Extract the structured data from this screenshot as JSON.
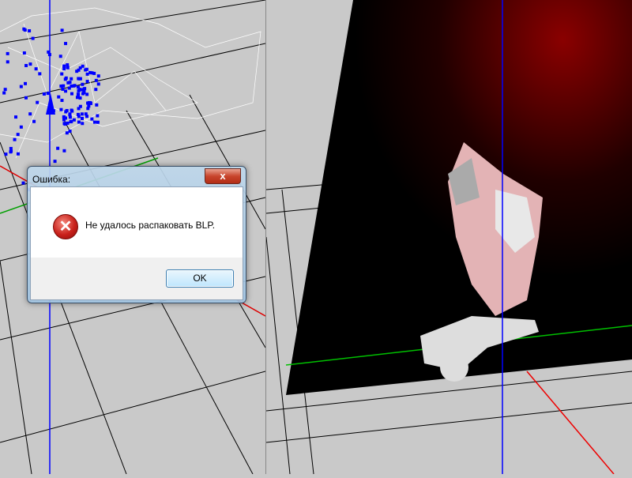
{
  "dialog": {
    "title": "Ошибка:",
    "close_label": "x",
    "icon": "error-icon",
    "message": "Не удалось распаковать BLP.",
    "ok_label": "OK"
  },
  "colors": {
    "axis_x": "#ff0000",
    "axis_y": "#00c000",
    "axis_z": "#0000ff",
    "viewport_bg": "#c9c9c9",
    "vertex": "#0000ff"
  }
}
